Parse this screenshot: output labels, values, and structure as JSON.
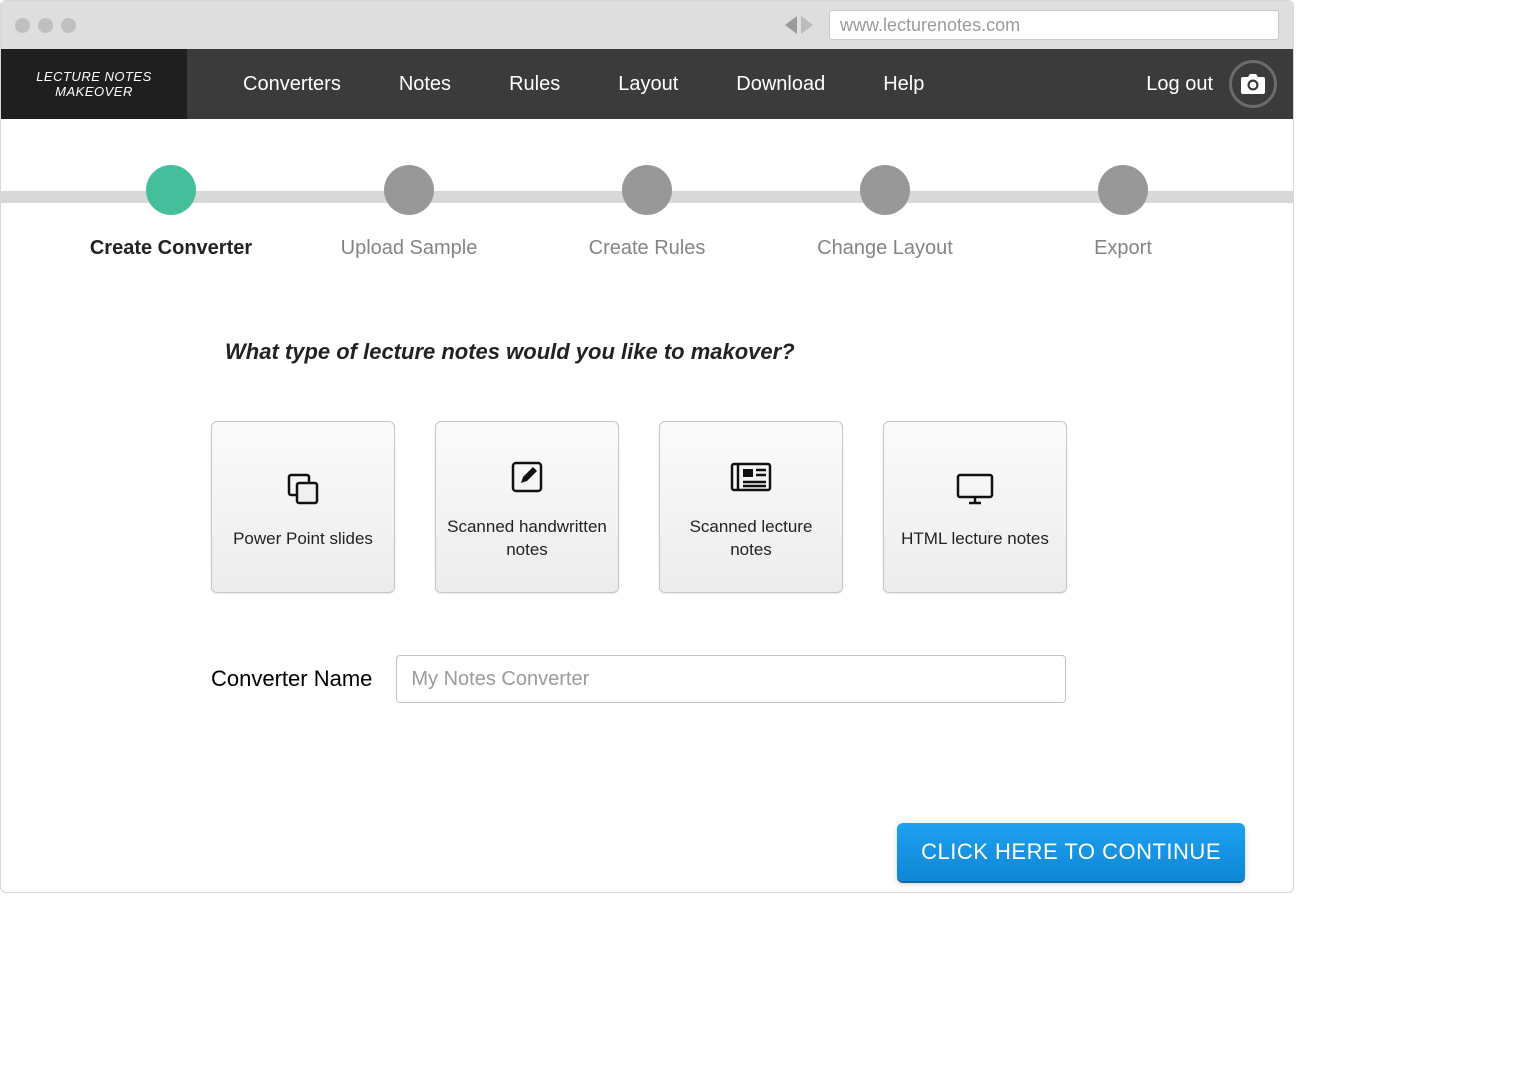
{
  "browser": {
    "url": "www.lecturenotes.com"
  },
  "brand": {
    "line1": "LECTURE NOTES",
    "line2": "MAKEOVER"
  },
  "nav": {
    "items": [
      "Converters",
      "Notes",
      "Rules",
      "Layout",
      "Download",
      "Help"
    ],
    "logout": "Log out"
  },
  "stepper": {
    "steps": [
      {
        "label": "Create Converter",
        "active": true
      },
      {
        "label": "Upload Sample",
        "active": false
      },
      {
        "label": "Create Rules",
        "active": false
      },
      {
        "label": "Change Layout",
        "active": false
      },
      {
        "label": "Export",
        "active": false
      }
    ]
  },
  "main": {
    "question": "What type of lecture notes would you like to makover?",
    "cards": [
      {
        "label": "Power Point slides",
        "icon": "copy-icon"
      },
      {
        "label": "Scanned handwritten notes",
        "icon": "edit-icon"
      },
      {
        "label": "Scanned lecture notes",
        "icon": "newspaper-icon"
      },
      {
        "label": "HTML lecture notes",
        "icon": "monitor-icon"
      }
    ],
    "converter_name_label": "Converter Name",
    "converter_name_placeholder": "My Notes Converter",
    "continue_label": "CLICK HERE TO CONTINUE"
  }
}
